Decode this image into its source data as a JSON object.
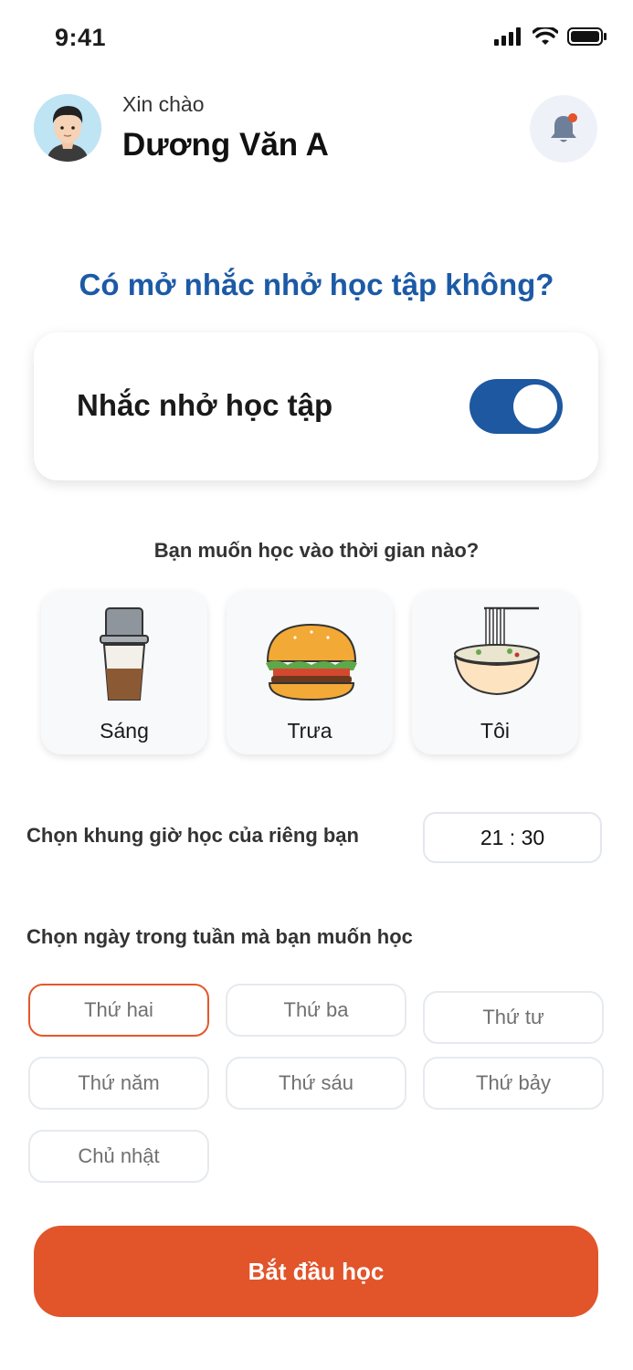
{
  "status_bar": {
    "time": "9:41"
  },
  "header": {
    "greeting": "Xin chào",
    "user_name": "Dương Văn A"
  },
  "question": "Có mở nhắc nhở học tập không?",
  "reminder": {
    "label": "Nhắc nhở học tập",
    "enabled": true
  },
  "time_question": "Bạn muốn học vào thời gian nào?",
  "meal_options": [
    {
      "label": "Sáng",
      "icon": "coffee-filter-icon"
    },
    {
      "label": "Trưa",
      "icon": "burger-icon"
    },
    {
      "label": "Tôi",
      "icon": "noodle-bowl-icon"
    }
  ],
  "custom_time": {
    "label": "Chọn khung giờ học của riêng bạn",
    "value": "21 : 30"
  },
  "days_question": "Chọn ngày trong tuần mà bạn muốn học",
  "days": [
    {
      "label": "Thứ hai",
      "selected": true
    },
    {
      "label": "Thứ ba",
      "selected": false
    },
    {
      "label": "Thứ tư",
      "selected": false
    },
    {
      "label": "Thứ năm",
      "selected": false
    },
    {
      "label": "Thứ sáu",
      "selected": false
    },
    {
      "label": "Thứ bảy",
      "selected": false
    },
    {
      "label": "Chủ nhật",
      "selected": false
    }
  ],
  "start_button": "Bắt đầu học",
  "colors": {
    "primary_blue": "#1d58a0",
    "accent_orange": "#e2542a"
  }
}
